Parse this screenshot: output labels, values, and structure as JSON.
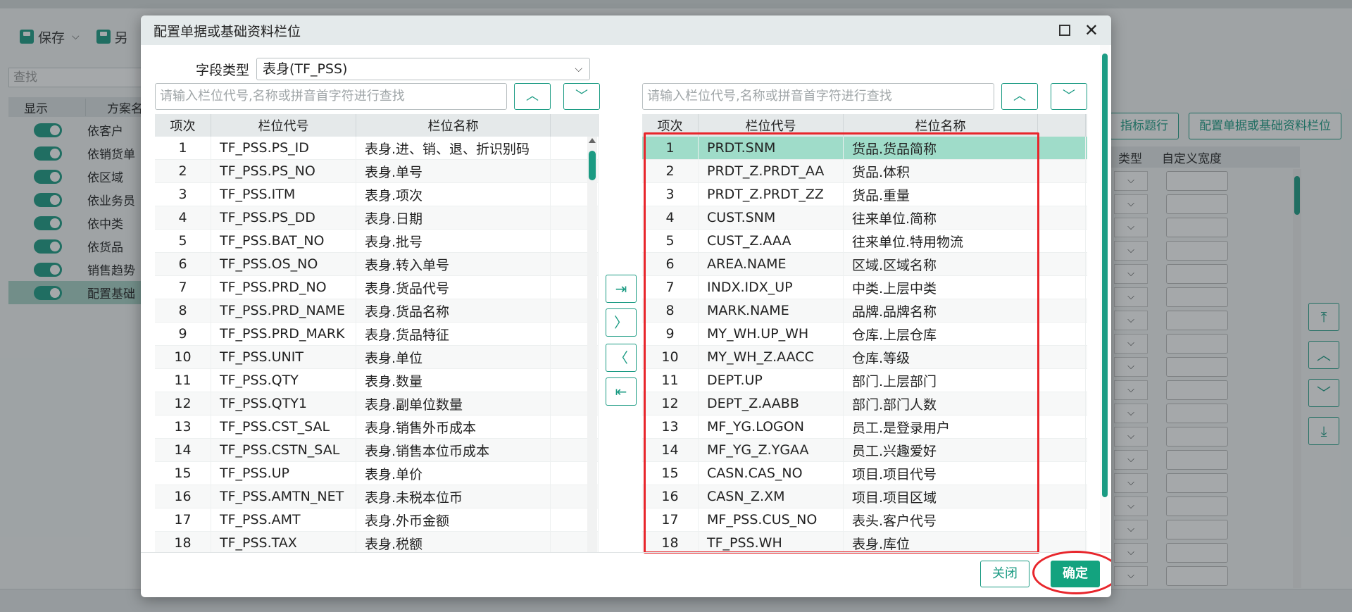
{
  "background": {
    "toolbar": [
      {
        "label": "保存",
        "icon": "save-icon"
      },
      {
        "label": "另",
        "icon": "save-as-icon"
      }
    ],
    "search_placeholder": "查找",
    "list_header": {
      "show": "显示",
      "plan": "方案名"
    },
    "list_items": [
      {
        "label": "依客户",
        "on": true
      },
      {
        "label": "依销货单",
        "on": true
      },
      {
        "label": "依区域",
        "on": true
      },
      {
        "label": "依业务员",
        "on": true
      },
      {
        "label": "依中类",
        "on": true
      },
      {
        "label": "依货品",
        "on": true
      },
      {
        "label": "销售趋势",
        "on": true
      },
      {
        "label": "配置基础",
        "on": true
      }
    ],
    "right_buttons": [
      "指标题行",
      "配置单据或基础资料栏位"
    ],
    "grid_header": {
      "type": "类型",
      "width": "自定义宽度"
    }
  },
  "dialog": {
    "title": "配置单据或基础资料栏位",
    "field_type_label": "字段类型",
    "field_type_value": "表身(TF_PSS)",
    "search_placeholder": "请输入栏位代号,名称或拼音首字符进行查找",
    "columns": {
      "idx": "项次",
      "code": "栏位代号",
      "name": "栏位名称"
    },
    "left_rows": [
      {
        "idx": "1",
        "code": "TF_PSS.PS_ID",
        "name": "表身.进、销、退、折识别码"
      },
      {
        "idx": "2",
        "code": "TF_PSS.PS_NO",
        "name": "表身.单号"
      },
      {
        "idx": "3",
        "code": "TF_PSS.ITM",
        "name": "表身.项次"
      },
      {
        "idx": "4",
        "code": "TF_PSS.PS_DD",
        "name": "表身.日期"
      },
      {
        "idx": "5",
        "code": "TF_PSS.BAT_NO",
        "name": "表身.批号"
      },
      {
        "idx": "6",
        "code": "TF_PSS.OS_NO",
        "name": "表身.转入单号"
      },
      {
        "idx": "7",
        "code": "TF_PSS.PRD_NO",
        "name": "表身.货品代号"
      },
      {
        "idx": "8",
        "code": "TF_PSS.PRD_NAME",
        "name": "表身.货品名称"
      },
      {
        "idx": "9",
        "code": "TF_PSS.PRD_MARK",
        "name": "表身.货品特征"
      },
      {
        "idx": "10",
        "code": "TF_PSS.UNIT",
        "name": "表身.单位"
      },
      {
        "idx": "11",
        "code": "TF_PSS.QTY",
        "name": "表身.数量"
      },
      {
        "idx": "12",
        "code": "TF_PSS.QTY1",
        "name": "表身.副单位数量"
      },
      {
        "idx": "13",
        "code": "TF_PSS.CST_SAL",
        "name": "表身.销售外币成本"
      },
      {
        "idx": "14",
        "code": "TF_PSS.CSTN_SAL",
        "name": "表身.销售本位币成本"
      },
      {
        "idx": "15",
        "code": "TF_PSS.UP",
        "name": "表身.单价"
      },
      {
        "idx": "16",
        "code": "TF_PSS.AMTN_NET",
        "name": "表身.未税本位币"
      },
      {
        "idx": "17",
        "code": "TF_PSS.AMT",
        "name": "表身.外币金额"
      },
      {
        "idx": "18",
        "code": "TF_PSS.TAX",
        "name": "表身.税额"
      }
    ],
    "right_rows": [
      {
        "idx": "1",
        "code": "PRDT.SNM",
        "name": "货品.货品简称"
      },
      {
        "idx": "2",
        "code": "PRDT_Z.PRDT_AA",
        "name": "货品.体积"
      },
      {
        "idx": "3",
        "code": "PRDT_Z.PRDT_ZZ",
        "name": "货品.重量"
      },
      {
        "idx": "4",
        "code": "CUST.SNM",
        "name": "往来单位.简称"
      },
      {
        "idx": "5",
        "code": "CUST_Z.AAA",
        "name": "往来单位.特用物流"
      },
      {
        "idx": "6",
        "code": "AREA.NAME",
        "name": "区域.区域名称"
      },
      {
        "idx": "7",
        "code": "INDX.IDX_UP",
        "name": "中类.上层中类"
      },
      {
        "idx": "8",
        "code": "MARK.NAME",
        "name": "品牌.品牌名称"
      },
      {
        "idx": "9",
        "code": "MY_WH.UP_WH",
        "name": "仓库.上层仓库"
      },
      {
        "idx": "10",
        "code": "MY_WH_Z.AACC",
        "name": "仓库.等级"
      },
      {
        "idx": "11",
        "code": "DEPT.UP",
        "name": "部门.上层部门"
      },
      {
        "idx": "12",
        "code": "DEPT_Z.AABB",
        "name": "部门.部门人数"
      },
      {
        "idx": "13",
        "code": "MF_YG.LOGON",
        "name": "员工.是登录用户"
      },
      {
        "idx": "14",
        "code": "MF_YG_Z.YGAA",
        "name": "员工.兴趣爱好"
      },
      {
        "idx": "15",
        "code": "CASN.CAS_NO",
        "name": "项目.项目代号"
      },
      {
        "idx": "16",
        "code": "CASN_Z.XM",
        "name": "项目.项目区域"
      },
      {
        "idx": "17",
        "code": "MF_PSS.CUS_NO",
        "name": "表头.客户代号"
      },
      {
        "idx": "18",
        "code": "TF_PSS.WH",
        "name": "表身.库位"
      }
    ],
    "buttons": {
      "close": "关闭",
      "ok": "确定"
    }
  },
  "colors": {
    "accent": "#1b9b83",
    "selected_row": "#9fdcc9",
    "highlight": "#e8262c"
  }
}
